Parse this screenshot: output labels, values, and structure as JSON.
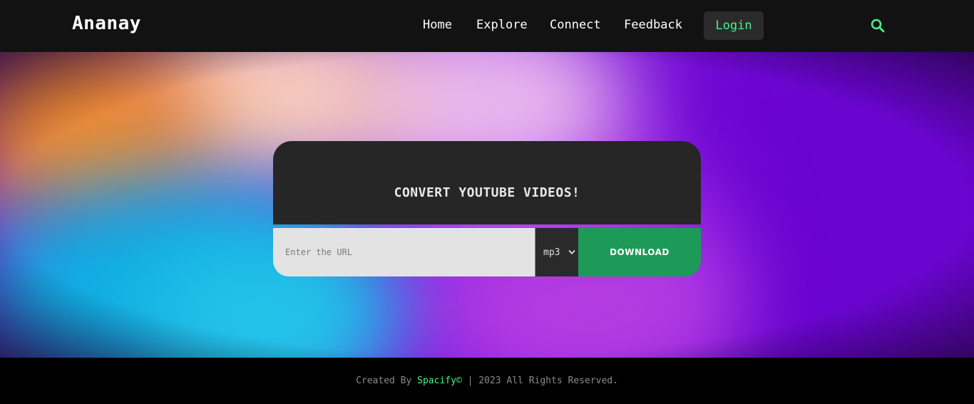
{
  "brand": "Ananay",
  "nav": {
    "home": "Home",
    "explore": "Explore",
    "connect": "Connect",
    "feedback": "Feedback",
    "login": "Login"
  },
  "icons": {
    "search": "search-icon",
    "select_chevron": "chevron-down-icon"
  },
  "converter": {
    "title": "CONVERT YOUTUBE VIDEOS!",
    "url_placeholder": "Enter the URL",
    "format_selected": "mp3",
    "download_label": "DOWNLOAD"
  },
  "footer": {
    "prefix": "Created By ",
    "brand": "Spacify©",
    "suffix": " | 2023 All Rights Reserved."
  },
  "colors": {
    "accent": "#4cf08a",
    "download_bg": "#1d9a58",
    "navbar_bg": "#121212",
    "card_bg": "#262626"
  }
}
